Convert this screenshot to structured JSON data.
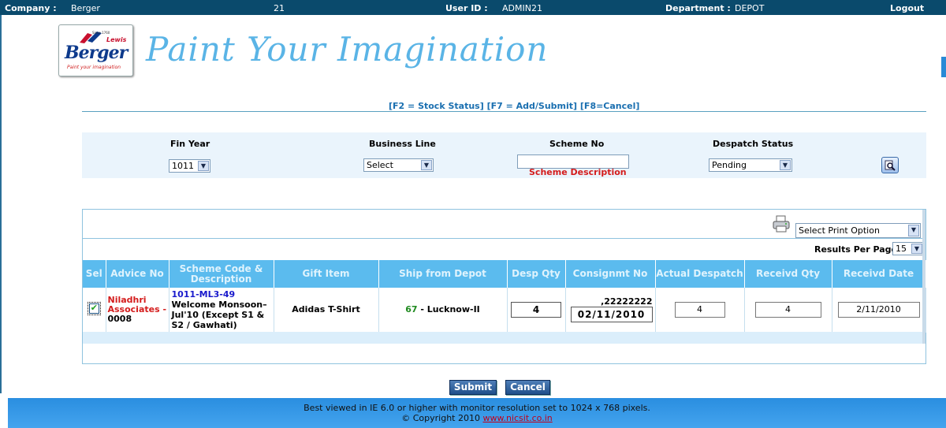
{
  "topbar": {
    "company_label": "Company :",
    "company_value": "Berger",
    "company_code": "21",
    "user_label": "User ID :",
    "user_value": "ADMIN21",
    "dept_label": "Department :",
    "dept_value": "DEPOT",
    "logout": "Logout"
  },
  "brand": {
    "logo_since": "Since 1760",
    "logo_lewis": "Lewis",
    "logo_word": "Berger",
    "logo_tag": "Paint your imagination",
    "tagline": "Paint Your Imagination",
    "colors": {
      "bar": "#0a4a6c",
      "header": "#5bbbee",
      "accent": "#d41c1c"
    }
  },
  "hotkeys": "[F2 = Stock Status] [F7 = Add/Submit]  [F8=Cancel]",
  "filters": {
    "fin_year_label": "Fin Year",
    "fin_year_value": "1011",
    "business_line_label": "Business Line",
    "business_line_value": "Select",
    "scheme_no_label": "Scheme No",
    "scheme_no_value": "",
    "scheme_description": "Scheme Description",
    "despatch_status_label": "Despatch Status",
    "despatch_status_value": "Pending",
    "search_icon": "magnifier-icon"
  },
  "grid": {
    "print_option": "Select Print Option",
    "results_per_page_label": "Results Per Page:",
    "results_per_page_value": "15",
    "columns": [
      "Sel",
      "Advice No",
      "Scheme Code & Description",
      "Gift Item",
      "Ship from Depot",
      "Desp Qty",
      "Consignmt No",
      "Actual Despatch",
      "Receivd Qty",
      "Receivd Date"
    ],
    "rows": [
      {
        "selected": true,
        "advice_name": "Niladhri Associates -",
        "advice_no": "0008",
        "scheme_code": "1011-ML3-49",
        "scheme_desc": "Welcome Monsoon–Jul'10 (Except S1 & S2 / Gawhati)",
        "gift_item": "Adidas T-Shirt",
        "depot_code": "67",
        "depot_name": " - Lucknow-II",
        "desp_qty": "4",
        "consignment_no": ",22222222",
        "consignment_date": "02/11/2010",
        "actual_despatch": "4",
        "received_qty": "4",
        "received_date": "2/11/2010"
      }
    ]
  },
  "buttons": {
    "submit": "Submit",
    "cancel": "Cancel"
  },
  "footer": {
    "line1": "Best viewed in IE 6.0 or higher with monitor resolution set to 1024 x 768 pixels.",
    "copyright": "© Copyright 2010 ",
    "link": "www.nicsit.co.in"
  }
}
